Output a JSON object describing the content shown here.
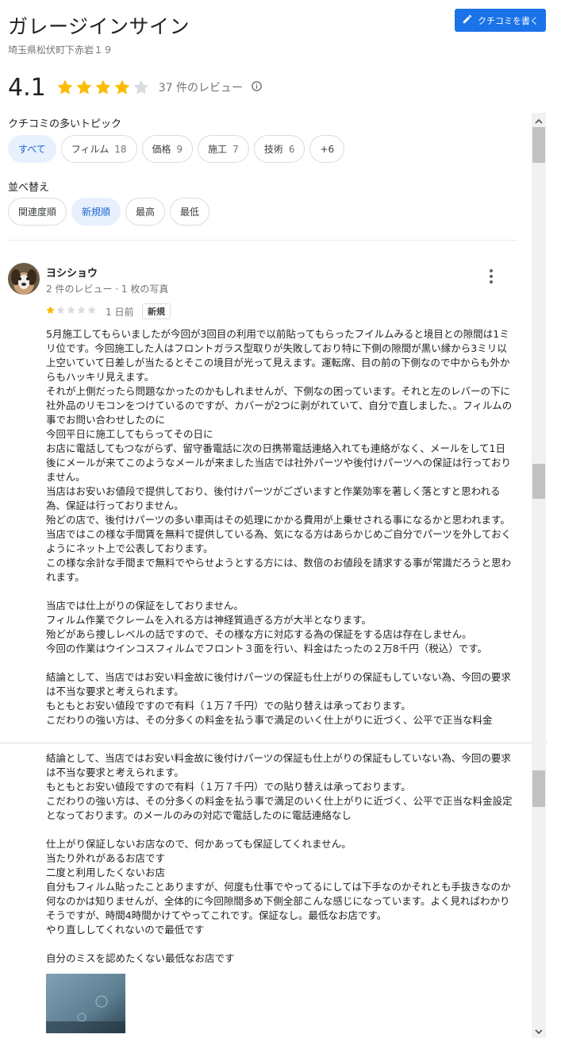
{
  "place": {
    "name": "ガレージインサイン",
    "address": "埼玉県松伏町下赤岩１９"
  },
  "write_review": {
    "label": "クチコミを書く",
    "icon": "pencil-icon"
  },
  "rating": {
    "value": "4.1",
    "stars": 4,
    "max": 5,
    "count_text": "37 件のレビュー",
    "star_color": "#fbbc04"
  },
  "topics": {
    "label": "クチコミの多いトピック",
    "chips": [
      {
        "label": "すべて",
        "count": "",
        "active": true
      },
      {
        "label": "フィルム",
        "count": "18",
        "active": false
      },
      {
        "label": "価格",
        "count": "9",
        "active": false
      },
      {
        "label": "施工",
        "count": "7",
        "active": false
      },
      {
        "label": "技術",
        "count": "6",
        "active": false
      },
      {
        "label": "+6",
        "count": "",
        "active": false
      }
    ]
  },
  "sort": {
    "label": "並べ替え",
    "options": [
      {
        "label": "関連度順",
        "active": false
      },
      {
        "label": "新規順",
        "active": true
      },
      {
        "label": "最高",
        "active": false
      },
      {
        "label": "最低",
        "active": false
      }
    ]
  },
  "review": {
    "author": "ヨシショウ",
    "meta": "2 件のレビュー · 1 枚の写真",
    "stars": 1,
    "date": "1 日前",
    "badge": "新規",
    "text_part1": "5月施工してもらいましたが今回が3回目の利用で以前貼ってもらったフイルムみると境目との隙間は1ミリ位です。今回施工した人はフロントガラス型取りが失敗しており特に下側の隙間が黒い縁から3ミリ以上空いていて日差しが当たるとそこの境目が光って見えます。運転席、目の前の下側なので中からも外からもハッキリ見えます。\nそれが上側だったら問題なかったのかもしれませんが、下側なの困っています。それと左のレバーの下に社外品のリモコンをつけているのですが、カバーが2つに剥がれていて、自分で直しました、。フィルムの事でお問い合わせしたのに\n今回平日に施工してもらってその日に\nお店に電話してもつながらず、留守番電話に次の日携帯電話連絡入れても連絡がなく、メールをして1日後にメールが来てこのようなメールが来ました当店では社外パーツや後付けパーツへの保証は行っておりません。\n当店はお安いお値段で提供しており、後付けパーツがございますと作業効率を著しく落とすと思われる為、保証は行っておりません。\n殆どの店で、後付けパーツの多い車両はその処理にかかる費用が上乗せされる事になるかと思われます。\n当店ではこの様な手間賃を無料で提供している為、気になる方はあらかじめご自分でパーツを外しておくようにネット上で公表しております。\nこの様な余計な手間まで無料でやらせようとする方には、数倍のお値段を請求する事が常識だろうと思われます。\n\n当店では仕上がりの保証をしておりません。\nフィルム作業でクレームを入れる方は神経質過ぎる方が大半となります。\n殆どがあら捜しレベルの話ですので、その様な方に対応する為の保証をする店は存在しません。\n今回の作業はウインコスフィルムでフロント３面を行い、料金はたったの２万8千円（税込）です。\n\n結論として、当店ではお安い料金故に後付けパーツの保証も仕上がりの保証もしていない為、今回の要求は不当な要求と考えられます。\nもともとお安い値段ですので有料（１万７千円）での貼り替えは承っております。\nこだわりの強い方は、その分多くの料金を払う事で満足のいく仕上がりに近づく、公平で正当な料金",
    "text_part2": "結論として、当店ではお安い料金故に後付けパーツの保証も仕上がりの保証もしていない為、今回の要求は不当な要求と考えられます。\nもともとお安い値段ですので有料（１万７千円）での貼り替えは承っております。\nこだわりの強い方は、その分多くの料金を払う事で満足のいく仕上がりに近づく、公平で正当な料金設定となっております。のメールのみの対応で電話したのに電話連絡なし\n\n仕上がり保証しないお店なので、何かあっても保証してくれません。\n当たり外れがあるお店です\n二度と利用したくないお店\n自分もフィルム貼ったことありますが、何度も仕事でやってるにしては下手なのかそれとも手抜きなのか何なのかは知りませんが、全体的に今回隙間多め下側全部こんな感じになっています。よく見ればわかりそうですが、時間4時間かけてやってこれです。保証なし。最低なお店です。\nやり直ししてくれないので最低です\n\n自分のミスを認めたくない最低なお店です"
  },
  "icons": {
    "info": "info-icon",
    "more": "more-vert-icon",
    "avatar": "dog-avatar"
  },
  "colors": {
    "accent": "#1a73e8",
    "chip_active_bg": "#e8f0fe",
    "chip_active_text": "#1967d2",
    "star_empty": "#dadce0"
  }
}
